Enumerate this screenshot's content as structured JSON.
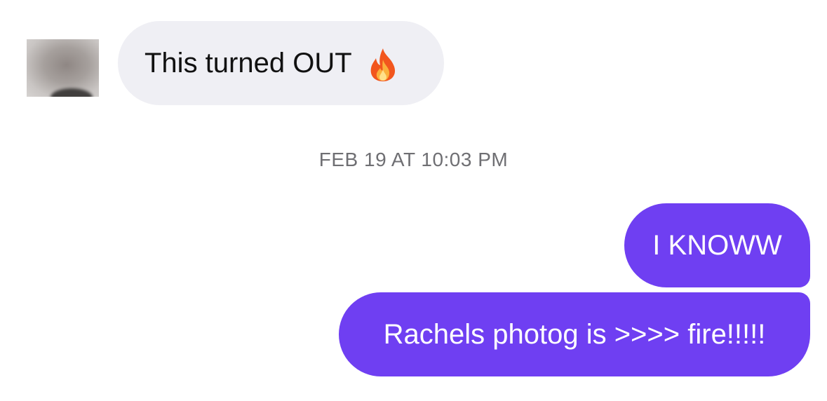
{
  "messages": {
    "incoming": {
      "text": "This turned OUT",
      "emoji": "fire-icon"
    },
    "timestamp": "FEB 19 AT 10:03 PM",
    "outgoing": [
      {
        "text": "I KNOWW"
      },
      {
        "text": "Rachels photog is >>>> fire!!!!!"
      }
    ]
  },
  "colors": {
    "incoming_bubble": "#efeff4",
    "outgoing_bubble": "#6f3ff2",
    "timestamp_text": "#6f6f73"
  }
}
